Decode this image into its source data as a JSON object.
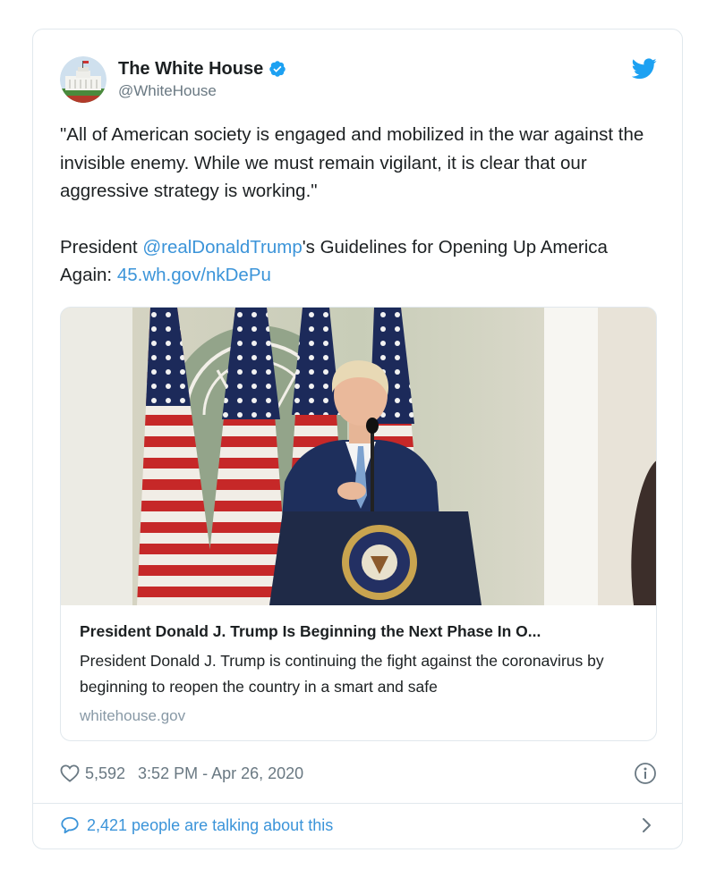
{
  "tweet": {
    "author_name": "The White House",
    "handle": "@WhiteHouse",
    "quote": "\"All of American society is engaged and mobilized in the war against the invisible enemy. While we must remain vigilant, it is clear that our aggressive strategy is working.\"",
    "text_before_mention": "President ",
    "mention": "@realDonaldTrump",
    "text_after_mention": "'s Guidelines for Opening Up America Again: ",
    "url": "45.wh.gov/nkDePu"
  },
  "card": {
    "title": "President Donald J. Trump Is Beginning the Next Phase In O...",
    "description": "President Donald J. Trump is continuing the fight against the coronavirus by beginning to reopen the country in a smart and safe",
    "domain": "whitehouse.gov"
  },
  "meta": {
    "like_count": "5,592",
    "timestamp": "3:52 PM - Apr 26, 2020"
  },
  "footer": {
    "talking": "2,421 people are talking about this"
  },
  "icons": {
    "verified": "verified-badge-icon",
    "brand": "twitter-bird-icon",
    "like": "heart-icon",
    "info": "info-icon",
    "reply": "speech-bubble-icon",
    "more": "chevron-right-icon"
  },
  "colors": {
    "link": "#3b94d9",
    "text": "#1c2022",
    "muted": "#697882",
    "border": "#e1e8ed"
  }
}
